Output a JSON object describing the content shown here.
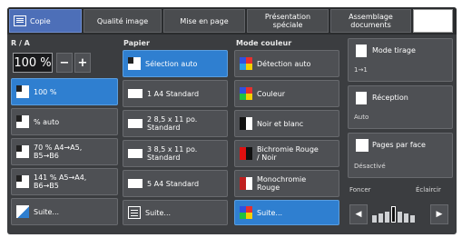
{
  "tabs": [
    {
      "label": "Copie"
    },
    {
      "label": "Qualité image"
    },
    {
      "label": "Mise en page"
    },
    {
      "label": "Présentation spéciale"
    },
    {
      "label": "Assemblage documents"
    }
  ],
  "reduce": {
    "label": "R / A",
    "value": "100 %",
    "minus": "−",
    "plus": "+",
    "options": [
      "100 %",
      "% auto",
      "70 % A4→A5, B5→B6",
      "141 % A5→A4, B6→B5",
      "Suite..."
    ],
    "selected_index": 0
  },
  "paper": {
    "label": "Papier",
    "options": [
      "Sélection auto",
      "1 A4 Standard",
      "2 8,5 x 11 po. Standard",
      "3 8,5 x 11 po. Standard",
      "5 A4 Standard",
      "Suite..."
    ],
    "selected_index": 0
  },
  "color_mode": {
    "label": "Mode couleur",
    "options": [
      "Détection auto",
      "Couleur",
      "Noir et blanc",
      "Bichromie Rouge / Noir",
      "Monochromie Rouge",
      "Suite..."
    ],
    "selected_index": 5
  },
  "right": {
    "mode": {
      "title": "Mode tirage",
      "value": "1→1"
    },
    "reception": {
      "title": "Réception",
      "value": "Auto"
    },
    "pages": {
      "title": "Pages par face",
      "value": "Désactivé"
    }
  },
  "density": {
    "left_label": "Foncer",
    "right_label": "Éclaircir",
    "left_arrow": "◀",
    "right_arrow": "▶",
    "level": 0.5
  }
}
